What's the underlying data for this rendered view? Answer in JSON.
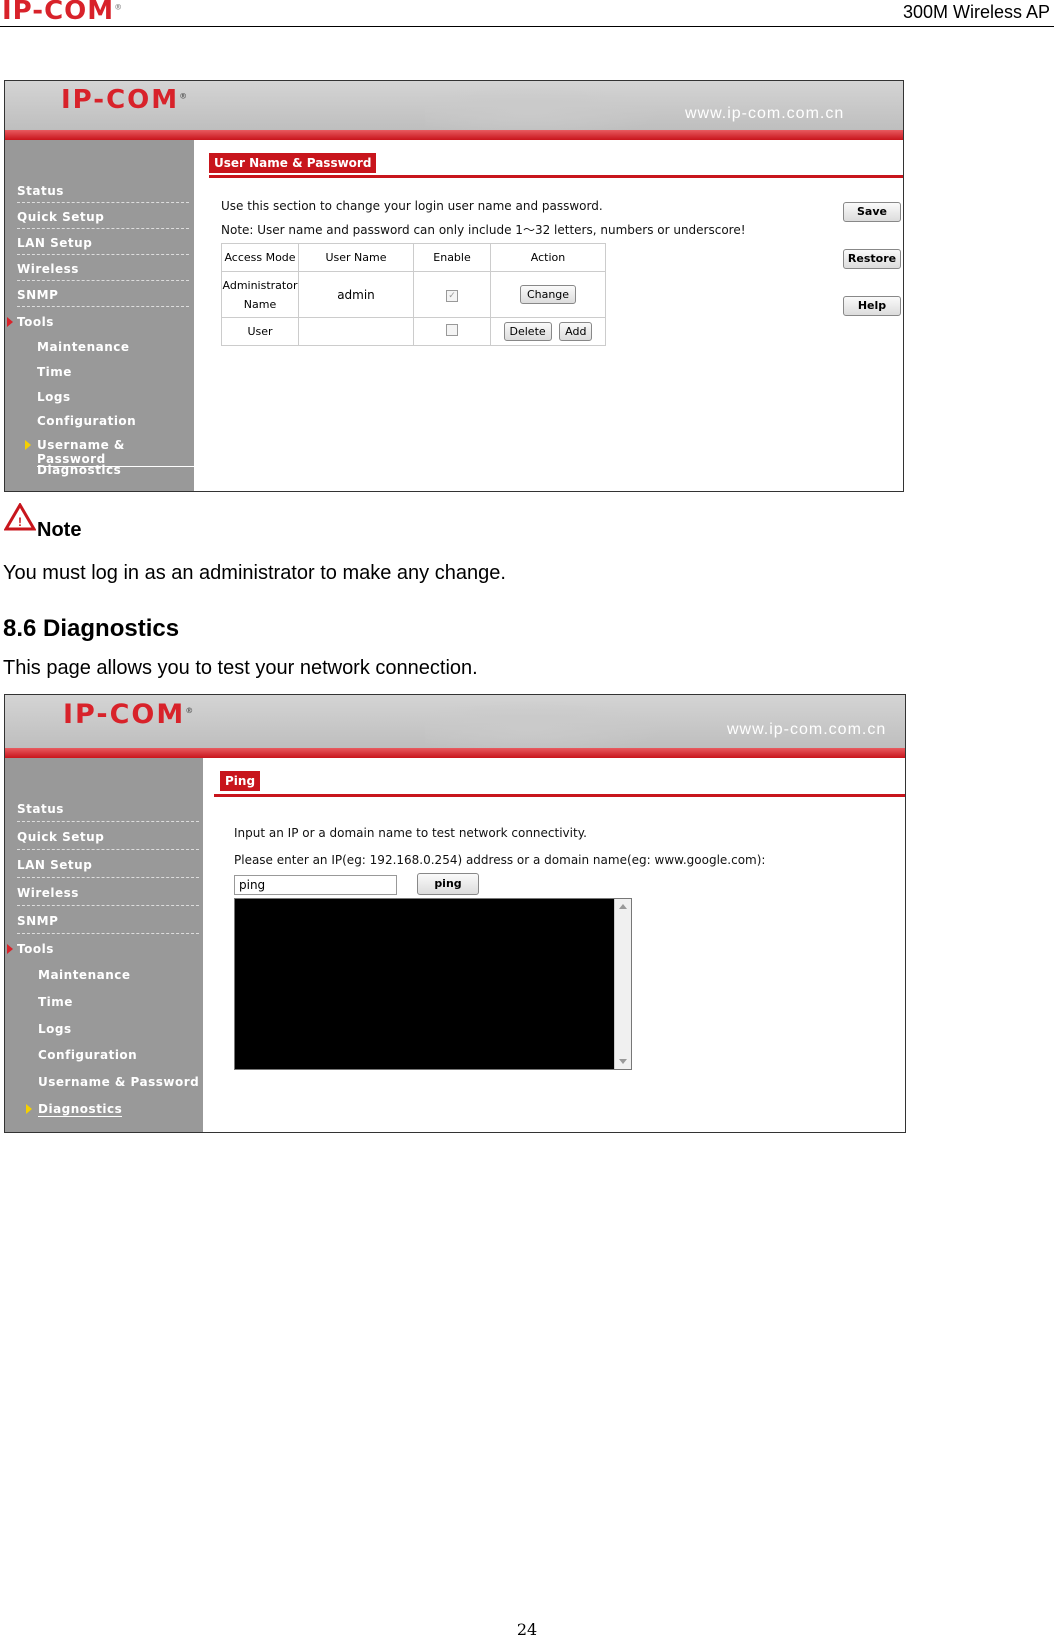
{
  "header": {
    "logo": "IP-COM",
    "title": "300M Wireless AP"
  },
  "screenshot1": {
    "logo": "IP-COM",
    "url": "www.ip-com.com.cn",
    "nav": {
      "main": [
        "Status",
        "Quick Setup",
        "LAN Setup",
        "Wireless",
        "SNMP",
        "Tools"
      ],
      "sub": [
        "Maintenance",
        "Time",
        "Logs",
        "Configuration",
        "Username & Password",
        "Diagnostics"
      ],
      "active_main": "Tools",
      "active_sub": "Username & Password"
    },
    "tab": "User Name & Password",
    "intro": "Use this section to change your login user name and password.",
    "note": "Note: User name and password can only include 1～32 letters, numbers or underscore!",
    "table": {
      "headers": [
        "Access Mode",
        "User Name",
        "Enable",
        "Action"
      ],
      "rows": [
        {
          "mode_line1": "Administrator",
          "mode_line2": "Name",
          "username": "admin",
          "enabled": true,
          "actions": [
            "Change"
          ]
        },
        {
          "mode_line1": "User",
          "mode_line2": "",
          "username": "",
          "enabled": false,
          "actions": [
            "Delete",
            "Add"
          ]
        }
      ]
    },
    "buttons": {
      "save": "Save",
      "restore": "Restore",
      "help": "Help"
    }
  },
  "note_section": {
    "label": "Note",
    "text": "You must log in as an administrator to make any change."
  },
  "section": {
    "heading": "8.6 Diagnostics",
    "text": "This page allows you to test your network connection."
  },
  "screenshot2": {
    "logo": "IP-COM",
    "url": "www.ip-com.com.cn",
    "nav": {
      "main": [
        "Status",
        "Quick Setup",
        "LAN Setup",
        "Wireless",
        "SNMP",
        "Tools"
      ],
      "sub": [
        "Maintenance",
        "Time",
        "Logs",
        "Configuration",
        "Username & Password",
        "Diagnostics"
      ],
      "active_main": "Tools",
      "active_sub": "Diagnostics"
    },
    "tab": "Ping",
    "intro": "Input an IP or a domain name to test network connectivity.",
    "prompt": "Please enter an IP(eg: 192.168.0.254) address or a domain name(eg: www.google.com):",
    "input_value": "ping",
    "ping_button": "ping"
  },
  "page_number": "24",
  "colors": {
    "brand_red": "#d8222a",
    "sidebar_gray": "#999999",
    "tab_red": "#c8151c"
  }
}
